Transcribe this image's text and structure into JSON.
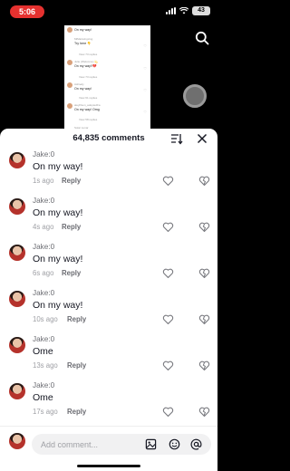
{
  "status_bar": {
    "time": "5:06",
    "battery": "43"
  },
  "video_preview": {
    "rows": [
      {
        "type": "text",
        "text": "On my way!"
      },
      {
        "type": "meta",
        "text": "MiMarieIngxing"
      },
      {
        "type": "text",
        "text": "Try here 👇"
      },
      {
        "type": "meta",
        "text": "View 73 replies"
      },
      {
        "type": "meta",
        "text": "Julie (Welcome) 💫"
      },
      {
        "type": "text",
        "text": "On my way!!💔"
      },
      {
        "type": "meta",
        "text": "View 73 replies"
      },
      {
        "type": "meta",
        "text": "Ashiedy"
      },
      {
        "type": "text",
        "text": "On my way!"
      },
      {
        "type": "meta",
        "text": "View 61 replies"
      },
      {
        "type": "meta",
        "text": "aleyPaon_adoptedFa"
      },
      {
        "type": "text",
        "text": "On my way! Omg"
      },
      {
        "type": "meta",
        "text": "View 58 replies"
      },
      {
        "type": "meta",
        "text": "Solar Lunar"
      }
    ]
  },
  "sheet": {
    "title": "64,835 comments"
  },
  "comments": [
    {
      "username": "Jake:0",
      "text": "On my way!",
      "time": "1s ago",
      "reply": "Reply"
    },
    {
      "username": "Jake:0",
      "text": "On my way!",
      "time": "4s ago",
      "reply": "Reply"
    },
    {
      "username": "Jake:0",
      "text": "On my way!",
      "time": "6s ago",
      "reply": "Reply"
    },
    {
      "username": "Jake:0",
      "text": "On my way!",
      "time": "10s ago",
      "reply": "Reply"
    },
    {
      "username": "Jake:0",
      "text": "Ome",
      "time": "13s ago",
      "reply": "Reply"
    },
    {
      "username": "Jake:0",
      "text": "Ome",
      "time": "17s ago",
      "reply": "Reply"
    }
  ],
  "composer": {
    "placeholder": "Add comment..."
  },
  "icons": {
    "search": "search-icon",
    "sort": "sort-icon",
    "close": "close-icon",
    "heart": "heart-icon",
    "dislike": "dislike-icon",
    "image": "image-icon",
    "emoji": "emoji-icon",
    "mention": "at-icon"
  },
  "colors": {
    "status_pill": "#e5312f",
    "text_primary": "#161823",
    "text_secondary": "#9fa0a5"
  }
}
